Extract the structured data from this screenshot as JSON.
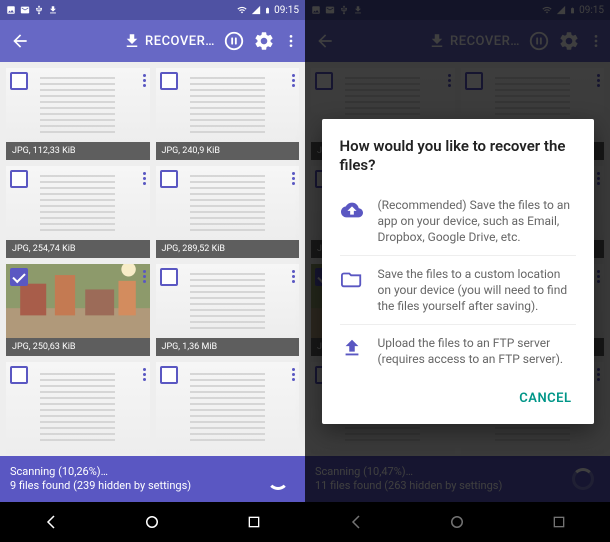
{
  "status": {
    "time": "09:15"
  },
  "appbar": {
    "title": "RECOVER…"
  },
  "left": {
    "cards": [
      {
        "caption": "JPG, 112,33 KiB",
        "type": "doc"
      },
      {
        "caption": "JPG, 240,9 KiB",
        "type": "doc"
      },
      {
        "caption": "JPG, 254,74 KiB",
        "type": "doc"
      },
      {
        "caption": "JPG, 289,52 KiB",
        "type": "doc"
      },
      {
        "caption": "JPG, 250,63 KiB",
        "type": "photo",
        "selected": true
      },
      {
        "caption": "JPG, 1,36 MiB",
        "type": "doc"
      },
      {
        "caption": "",
        "type": "doc",
        "nocap": true
      },
      {
        "caption": "",
        "type": "doc",
        "nocap": true
      }
    ],
    "scanning_line1": "Scanning (10,26%)…",
    "scanning_line2": "9 files found (239 hidden by settings)"
  },
  "right": {
    "scanning_line1": "Scanning (10,47%)…",
    "scanning_line2": "11 files found (263 hidden by settings)"
  },
  "dialog": {
    "title": "How would you like to recover the files?",
    "opt1": "(Recommended) Save the files to an app on your device, such as Email, Dropbox, Google Drive, etc.",
    "opt2": "Save the files to a custom location on your device (you will need to find the files yourself after saving).",
    "opt3": "Upload the files to an FTP server (requires access to an FTP server).",
    "cancel": "CANCEL"
  }
}
